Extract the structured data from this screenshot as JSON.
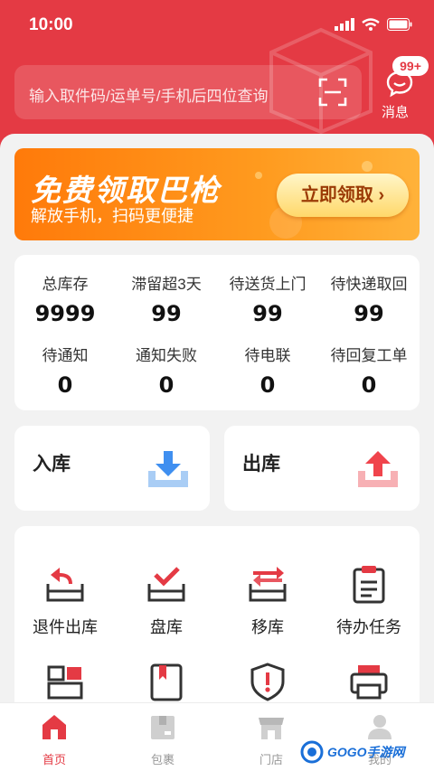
{
  "status": {
    "time": "10:00"
  },
  "search": {
    "placeholder": "输入取件码/运单号/手机后四位查询"
  },
  "message": {
    "badge": "99+",
    "label": "消息"
  },
  "banner": {
    "title": "免费领取巴枪",
    "subtitle": "解放手机，扫码更便捷",
    "button": "立即领取 ›"
  },
  "stats": [
    {
      "label": "总库存",
      "value": "9999"
    },
    {
      "label": "滞留超3天",
      "value": "99"
    },
    {
      "label": "待送货上门",
      "value": "99"
    },
    {
      "label": "待快递取回",
      "value": "99"
    },
    {
      "label": "待通知",
      "value": "0"
    },
    {
      "label": "通知失败",
      "value": "0"
    },
    {
      "label": "待电联",
      "value": "0"
    },
    {
      "label": "待回复工单",
      "value": "0"
    }
  ],
  "cards": {
    "inbound": "入库",
    "outbound": "出库"
  },
  "grid": [
    {
      "label": "退件出库",
      "icon": "return-out-icon"
    },
    {
      "label": "盘库",
      "icon": "inventory-check-icon"
    },
    {
      "label": "移库",
      "icon": "transfer-icon"
    },
    {
      "label": "待办任务",
      "icon": "clipboard-icon"
    },
    {
      "label": "",
      "icon": "boxes-icon"
    },
    {
      "label": "",
      "icon": "book-icon"
    },
    {
      "label": "",
      "icon": "shield-alert-icon"
    },
    {
      "label": "",
      "icon": "printer-icon"
    }
  ],
  "tabs": [
    {
      "label": "首页",
      "icon": "home-icon",
      "active": true
    },
    {
      "label": "包裹",
      "icon": "package-icon"
    },
    {
      "label": "门店",
      "icon": "store-icon"
    },
    {
      "label": "我的",
      "icon": "user-icon"
    }
  ],
  "watermark": {
    "text": "GOGO手游网"
  },
  "colors": {
    "brand": "#e43a44",
    "banner_orange": "#ff8a14",
    "inbound_blue": "#3f8ff0",
    "outbound_red": "#f0444c"
  }
}
